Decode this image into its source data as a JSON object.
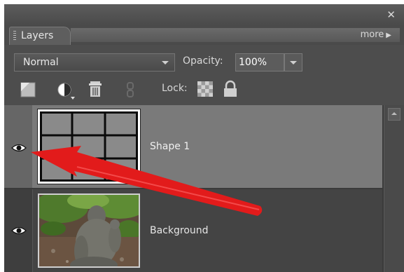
{
  "panel": {
    "close_icon": "close-icon",
    "tab_label": "Layers",
    "more_label": "more"
  },
  "controls": {
    "blend_mode": "Normal",
    "opacity_label": "Opacity:",
    "opacity_value": "100%",
    "lock_label": "Lock:"
  },
  "layers": [
    {
      "name": "Shape 1",
      "visible": true,
      "selected": true
    },
    {
      "name": "Background",
      "visible": true,
      "selected": false
    }
  ],
  "colors": {
    "panel_bg": "#3c3c3c",
    "selected_row": "#7a7a7a",
    "annotation_arrow": "#e21b1b"
  }
}
